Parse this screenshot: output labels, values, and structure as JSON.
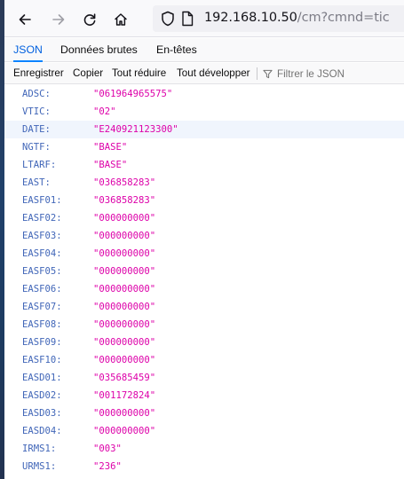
{
  "browser": {
    "url_host": "192.168.10.50",
    "url_path": "/cm?cmnd=tic"
  },
  "viewer": {
    "tabs": [
      {
        "label": "JSON"
      },
      {
        "label": "Données brutes"
      },
      {
        "label": "En-têtes"
      }
    ],
    "toolbar": {
      "save": "Enregistrer",
      "copy": "Copier",
      "collapse_all": "Tout réduire",
      "expand_all": "Tout développer",
      "filter_placeholder": "Filtrer le JSON"
    }
  },
  "json_rows": [
    {
      "key": "ADSC:",
      "value": "\"061964965575\""
    },
    {
      "key": "VTIC:",
      "value": "\"02\""
    },
    {
      "key": "DATE:",
      "value": "\"E240921123300\""
    },
    {
      "key": "NGTF:",
      "value": "\"BASE\""
    },
    {
      "key": "LTARF:",
      "value": "\"BASE\""
    },
    {
      "key": "EAST:",
      "value": "\"036858283\""
    },
    {
      "key": "EASF01:",
      "value": "\"036858283\""
    },
    {
      "key": "EASF02:",
      "value": "\"000000000\""
    },
    {
      "key": "EASF03:",
      "value": "\"000000000\""
    },
    {
      "key": "EASF04:",
      "value": "\"000000000\""
    },
    {
      "key": "EASF05:",
      "value": "\"000000000\""
    },
    {
      "key": "EASF06:",
      "value": "\"000000000\""
    },
    {
      "key": "EASF07:",
      "value": "\"000000000\""
    },
    {
      "key": "EASF08:",
      "value": "\"000000000\""
    },
    {
      "key": "EASF09:",
      "value": "\"000000000\""
    },
    {
      "key": "EASF10:",
      "value": "\"000000000\""
    },
    {
      "key": "EASD01:",
      "value": "\"035685459\""
    },
    {
      "key": "EASD02:",
      "value": "\"001172824\""
    },
    {
      "key": "EASD03:",
      "value": "\"000000000\""
    },
    {
      "key": "EASD04:",
      "value": "\"000000000\""
    },
    {
      "key": "IRMS1:",
      "value": "\"003\""
    },
    {
      "key": "URMS1:",
      "value": "\"236\""
    }
  ],
  "highlighted_row": 2,
  "icons": [
    "back-arrow-icon",
    "forward-arrow-icon",
    "reload-icon",
    "home-icon",
    "shield-icon",
    "page-icon",
    "filter-icon"
  ],
  "colors": {
    "key": "#4166b8",
    "value": "#dd00a9",
    "active_tab": "#0060df",
    "highlight_row": "#f0f5fd"
  }
}
